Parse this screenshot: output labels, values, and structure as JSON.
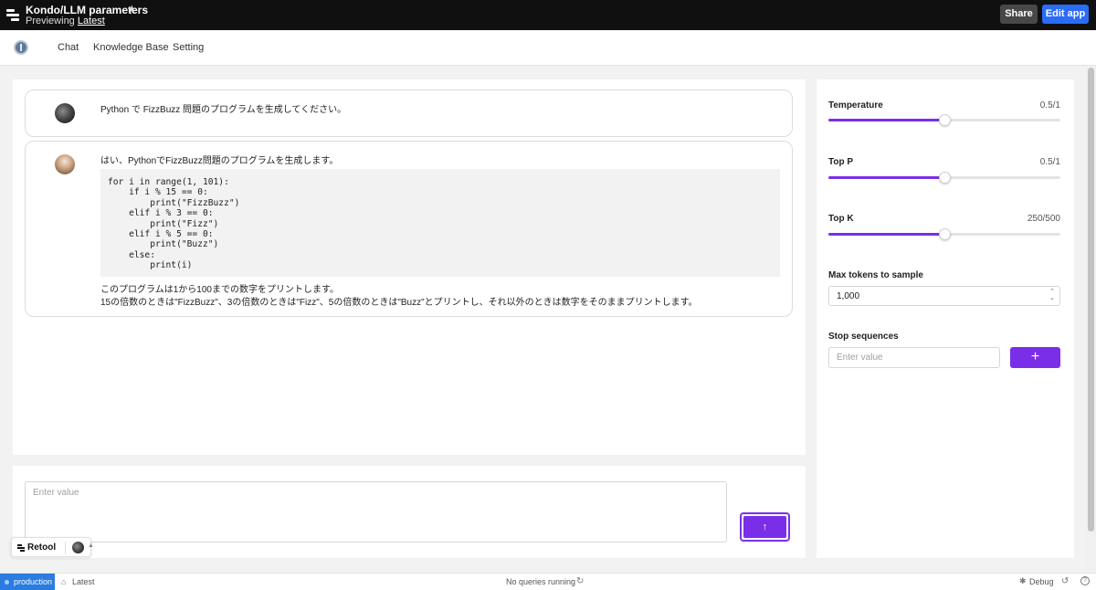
{
  "topbar": {
    "app_title": "Kondo/LLM parameters",
    "preview_prefix": "Previewing",
    "preview_version": "Latest",
    "share_label": "Share",
    "edit_label": "Edit app"
  },
  "nav": {
    "items": [
      {
        "label": "Chat"
      },
      {
        "label": "Knowledge Base"
      },
      {
        "label": "Setting"
      }
    ]
  },
  "chat": {
    "messages": [
      {
        "role": "user",
        "text": "Python で FizzBuzz 問題のプログラムを生成してください。"
      },
      {
        "role": "assistant",
        "intro": "はい、PythonでFizzBuzz問題のプログラムを生成します。",
        "code": "for i in range(1, 101):\n    if i % 15 == 0:\n        print(\"FizzBuzz\")\n    elif i % 3 == 0:\n        print(\"Fizz\")\n    elif i % 5 == 0:\n        print(\"Buzz\")\n    else:\n        print(i)",
        "outro_1": "このプログラムは1から100までの数字をプリントします。",
        "outro_2": "15の倍数のときは\"FizzBuzz\"、3の倍数のときは\"Fizz\"、5の倍数のときは\"Buzz\"とプリントし、それ以外のときは数字をそのままプリントします。"
      }
    ],
    "input_placeholder": "Enter value",
    "send_icon": "arrow-up-icon"
  },
  "settings": {
    "temperature": {
      "label": "Temperature",
      "display": "0.5/1",
      "fraction": 0.5
    },
    "top_p": {
      "label": "Top P",
      "display": "0.5/1",
      "fraction": 0.5
    },
    "top_k": {
      "label": "Top K",
      "display": "250/500",
      "fraction": 0.5
    },
    "max_tokens": {
      "label": "Max tokens to sample",
      "value": "1,000"
    },
    "stop_sequences": {
      "label": "Stop sequences",
      "placeholder": "Enter value",
      "add_icon": "plus-icon"
    }
  },
  "badge": {
    "label": "Retool"
  },
  "status": {
    "environment": "production",
    "version": "Latest",
    "queries": "No queries running",
    "debug": "Debug"
  },
  "colors": {
    "accent": "#7a2ee8",
    "primary_button": "#2a6cf6",
    "environment": "#2b7ce0"
  }
}
